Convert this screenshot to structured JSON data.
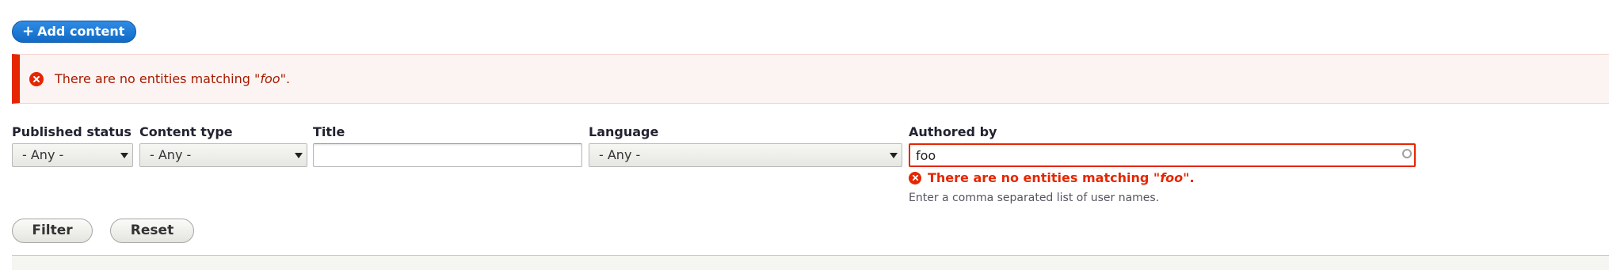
{
  "toolbar": {
    "add_content_prefix": "+",
    "add_content_label": "Add content"
  },
  "message": {
    "type": "error",
    "text_before": "There are no entities matching \"",
    "term": "foo",
    "text_after": "\".",
    "icon": "error-circle-x-icon"
  },
  "filters": {
    "published_status": {
      "label": "Published status",
      "value": "- Any -"
    },
    "content_type": {
      "label": "Content type",
      "value": "- Any -"
    },
    "title": {
      "label": "Title",
      "value": ""
    },
    "language": {
      "label": "Language",
      "value": "- Any -"
    },
    "authored_by": {
      "label": "Authored by",
      "value": "foo",
      "error_before": "There are no entities matching \"",
      "error_term": "foo",
      "error_after": "\".",
      "description": "Enter a comma separated list of user names."
    }
  },
  "actions": {
    "filter_label": "Filter",
    "reset_label": "Reset"
  },
  "colors": {
    "primary": "#0f6bc6",
    "error": "#e62600",
    "error_text": "#a51b00",
    "error_bg": "#fcf4f2"
  }
}
